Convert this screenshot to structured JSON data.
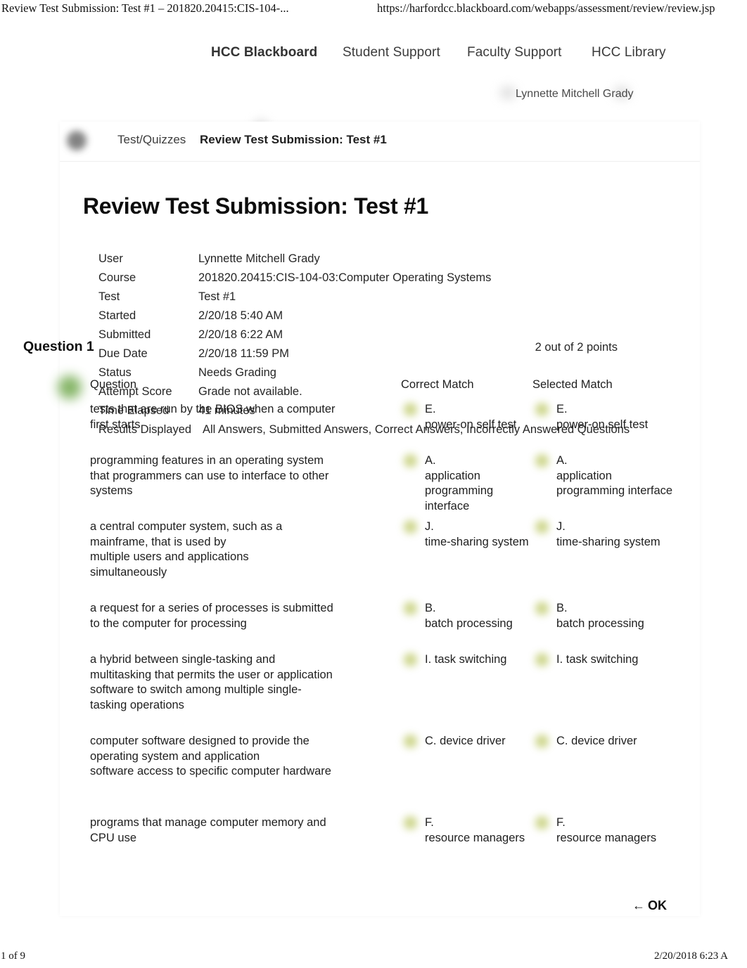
{
  "print_chrome": {
    "header_left": "Review Test Submission: Test #1 – 201820.20415:CIS-104-...",
    "header_right": "https://harfordcc.blackboard.com/webapps/assessment/review/review.jsp",
    "footer_left": "1 of 9",
    "footer_right": "2/20/2018 6:23 A"
  },
  "topnav": {
    "items": [
      {
        "label": "HCC Blackboard"
      },
      {
        "label": "Student Support"
      },
      {
        "label": "Faculty Support"
      },
      {
        "label": "HCC Library"
      }
    ],
    "user_name": "Lynnette Mitchell Grady"
  },
  "breadcrumb": {
    "parent": "Test/Quizzes",
    "current": "Review Test Submission: Test #1"
  },
  "page": {
    "title": "Review Test Submission: Test #1"
  },
  "summary": {
    "rows": [
      {
        "label": "User",
        "value": "Lynnette Mitchell Grady"
      },
      {
        "label": "Course",
        "value": "201820.20415:CIS-104-03:Computer Operating Systems"
      },
      {
        "label": "Test",
        "value": "Test #1"
      },
      {
        "label": "Started",
        "value": "2/20/18 5:40 AM"
      },
      {
        "label": "Submitted",
        "value": "2/20/18 6:22 AM"
      },
      {
        "label": "Due Date",
        "value": "2/20/18 11:59 PM"
      },
      {
        "label": "Status",
        "value": "Needs Grading"
      },
      {
        "label": "Attempt Score",
        "value": "Grade not available."
      },
      {
        "label": "Time Elapsed",
        "value": "41 minutes"
      },
      {
        "label": "Results Displayed",
        "value": "All Answers, Submitted Answers, Correct Answers, Incorrectly Answered Questions"
      }
    ]
  },
  "question": {
    "label": "Question 1",
    "points": "2 out of 2 points",
    "columns": {
      "question": "Question",
      "correct": "Correct Match",
      "selected": "Selected Match"
    },
    "rows": [
      {
        "question": "tests that are run by the BIOS when a computer first starts",
        "correct": "E.\npower-on self test",
        "selected": "E.\npower-on self test"
      },
      {
        "question": "programming features in an operating system that programmers can use to interface to other systems",
        "correct": "A.\napplication\nprogramming interface",
        "selected": "A.\napplication\nprogramming interface"
      },
      {
        "question": "a central computer system, such as a mainframe, that is used by\nmultiple users and applications\nsimultaneously",
        "correct": "J.\ntime-sharing system",
        "selected": "J.\ntime-sharing system"
      },
      {
        "question": "a request for a series of processes is submitted to the computer for processing",
        "correct": "B.\nbatch processing",
        "selected": "B.\nbatch processing"
      },
      {
        "question": "a hybrid between single-tasking and multitasking that permits the user or application software to switch among multiple single-tasking operations",
        "correct": "I. task switching",
        "selected": "I. task switching"
      },
      {
        "question": "computer software designed to provide the operating system and application\nsoftware access to specific computer hardware",
        "correct": "C. device driver",
        "selected": "C. device driver"
      },
      {
        "question": "programs that manage computer memory and CPU use",
        "correct": "F.\nresource managers",
        "selected": "F.\nresource managers"
      }
    ]
  },
  "actions": {
    "ok_label": "OK",
    "ok_arrow": "←"
  },
  "colors": {
    "correct_marker": "#63a03c",
    "answer_marker": "#b8c45a",
    "text": "#1f1f1f"
  }
}
